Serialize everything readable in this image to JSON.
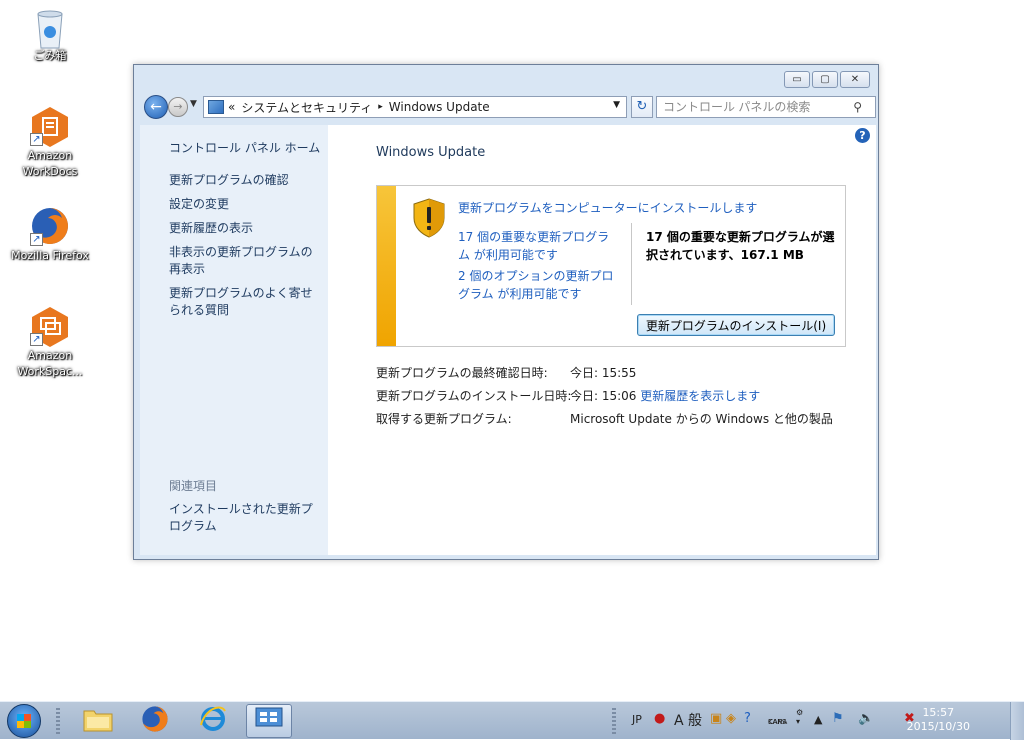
{
  "desktop": {
    "icons": [
      {
        "label": "ごみ箱"
      },
      {
        "label": "Amazon WorkDocs"
      },
      {
        "label": "Mozilla Firefox"
      },
      {
        "label": "Amazon WorkSpac..."
      }
    ]
  },
  "window": {
    "controls": {
      "minimize": "▭",
      "maximize": "▢",
      "close": "✕"
    },
    "address": {
      "prefix": "«",
      "crumb1": "システムとセキュリティ",
      "sep": "▸",
      "crumb2": "Windows Update"
    },
    "search_placeholder": "コントロール パネルの検索",
    "left_pane": {
      "home": "コントロール パネル ホーム",
      "links": [
        "更新プログラムの確認",
        "設定の変更",
        "更新履歴の表示",
        "非表示の更新プログラムの再表示",
        "更新プログラムのよく寄せられる質問"
      ],
      "related_heading": "関連項目",
      "related_link": "インストールされた更新プログラム"
    },
    "main": {
      "title": "Windows Update",
      "panel": {
        "heading": "更新プログラムをコンピューターにインストールします",
        "important_link": "17 個の重要な更新プログラム が利用可能です",
        "optional_link": "2 個のオプションの更新プログラム が利用可能です",
        "summary": "17 個の重要な更新プログラムが選択されています、167.1 MB",
        "install_button": "更新プログラムのインストール(I)"
      },
      "info": [
        {
          "key": "更新プログラムの最終確認日時:",
          "value": "今日: 15:55",
          "link": ""
        },
        {
          "key": "更新プログラムのインストール日時:",
          "value": "今日: 15:06",
          "link": "更新履歴を表示します"
        },
        {
          "key": "取得する更新プログラム:",
          "value": "Microsoft Update からの Windows と他の製品",
          "link": ""
        }
      ]
    }
  },
  "taskbar": {
    "tray": {
      "lang": "JP",
      "ime": "A 般",
      "caps": "CAPS",
      "kana": "KANA"
    },
    "clock": {
      "time": "15:57",
      "date": "2015/10/30"
    }
  }
}
